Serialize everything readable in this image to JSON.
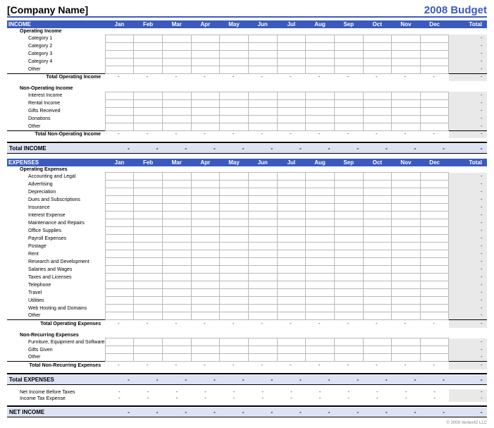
{
  "header": {
    "company": "[Company Name]",
    "budget": "2008 Budget"
  },
  "months": [
    "Jan",
    "Feb",
    "Mar",
    "Apr",
    "May",
    "Jun",
    "Jul",
    "Aug",
    "Sep",
    "Oct",
    "Nov",
    "Dec"
  ],
  "totalLabel": "Total",
  "dash": "-",
  "income": {
    "title": "INCOME",
    "op": {
      "header": "Operating Income",
      "items": [
        "Category 1",
        "Category 2",
        "Category 3",
        "Category 4",
        "Other"
      ],
      "subtotal": "Total Operating Income"
    },
    "nonop": {
      "header": "Non-Operating Income",
      "items": [
        "Interest Income",
        "Rental Income",
        "Gifts Received",
        "Donations",
        "Other"
      ],
      "subtotal": "Total Non-Operating Income"
    },
    "total": "Total INCOME"
  },
  "expenses": {
    "title": "EXPENSES",
    "op": {
      "header": "Operating Expenses",
      "items": [
        "Accounting and Legal",
        "Advertising",
        "Depreciation",
        "Dues and Subscriptions",
        "Insurance",
        "Interest Expense",
        "Maintenance and Repairs",
        "Office Supplies",
        "Payroll Expenses",
        "Postage",
        "Rent",
        "Research and Development",
        "Salaries and Wages",
        "Taxes and Licenses",
        "Telephone",
        "Travel",
        "Utilities",
        "Web Hosting and Domains",
        "Other"
      ],
      "subtotal": "Total Operating Expenses"
    },
    "nonrec": {
      "header": "Non-Recurring Expenses",
      "items": [
        "Furniture, Equipment and Software",
        "Gifts Given",
        "Other"
      ],
      "subtotal": "Total Non-Recurring Expenses"
    },
    "total": "Total EXPENSES"
  },
  "net": {
    "before": "Net Income Before Taxes",
    "tax": "Income Tax Expense",
    "title": "NET INCOME"
  },
  "footer": "© 2009 Vertex42 LLC"
}
